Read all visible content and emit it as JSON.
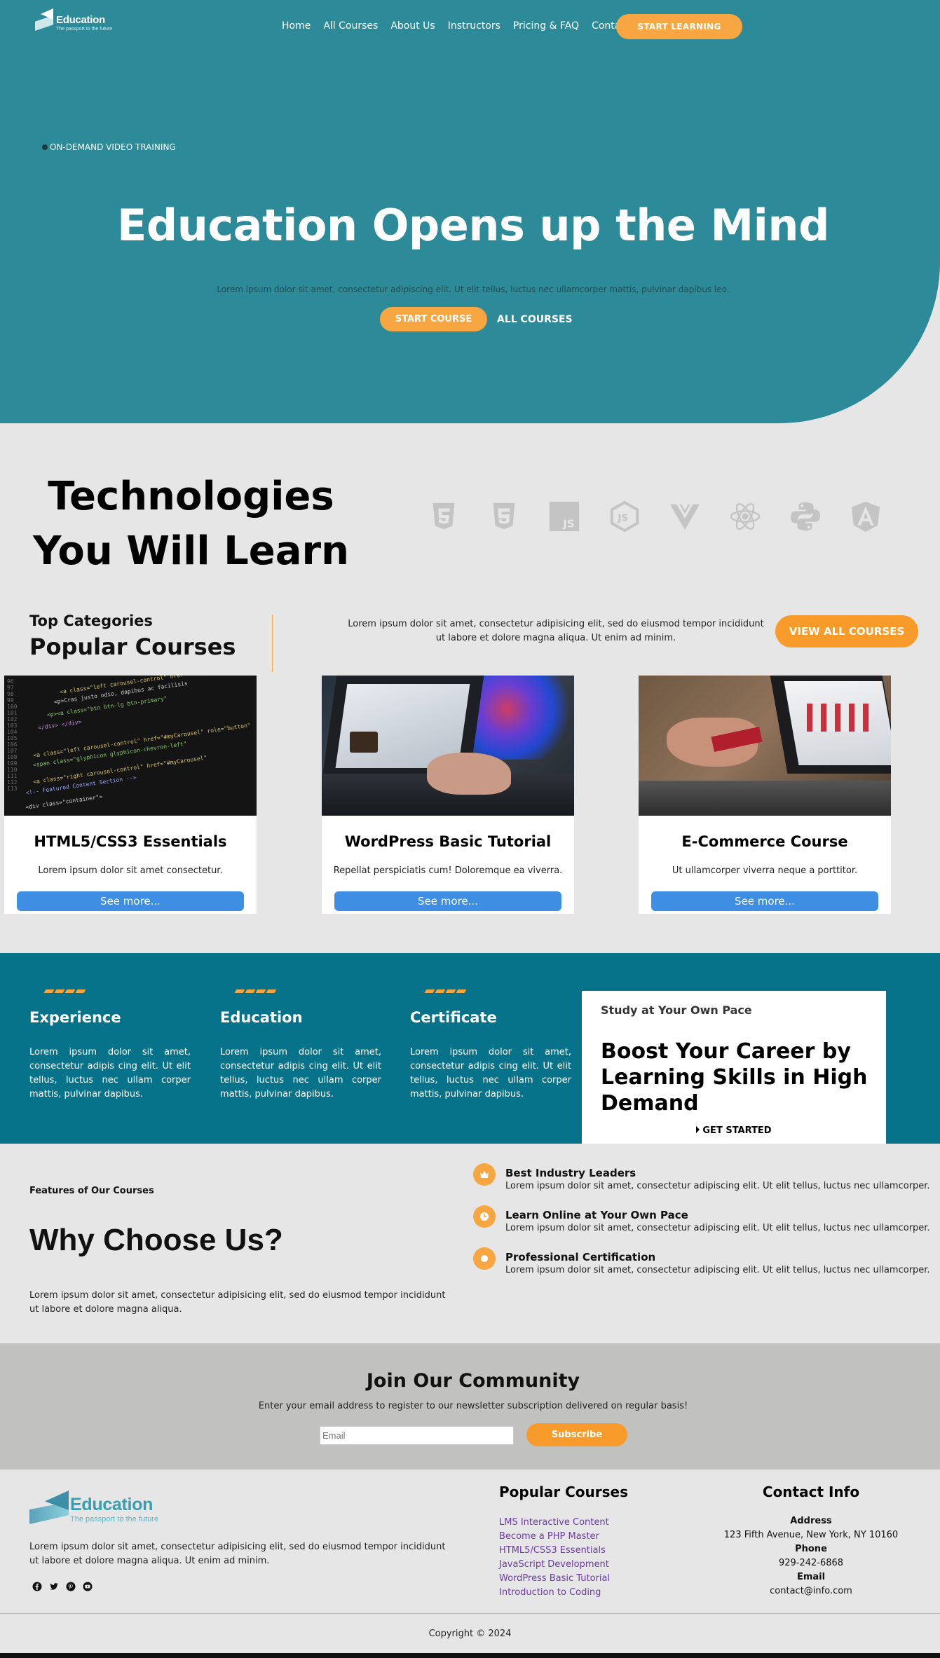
{
  "brand": {
    "name": "Education",
    "tagline": "The passport to the future"
  },
  "nav": {
    "links": [
      "Home",
      "All Courses",
      "About Us",
      "Instructors",
      "Pricing & FAQ",
      "Contact"
    ],
    "cta": "START LEARNING"
  },
  "hero": {
    "eyebrow": "ON-DEMAND VIDEO TRAINING",
    "title": "Education Opens up the Mind",
    "subtitle": "Lorem ipsum dolor sit amet, consectetur adipiscing elit. Ut elit tellus, luctus nec ullamcorper mattis, pulvinar dapibus leo.",
    "primary_button": "START COURSE",
    "secondary_button": "ALL COURSES",
    "colors": {
      "background": "#2c8a99",
      "accent": "#f7a641"
    }
  },
  "technologies": {
    "title_line1": "Technologies",
    "title_line2": "You Will Learn",
    "icons": [
      "html5-icon",
      "css3-icon",
      "javascript-icon",
      "nodejs-icon",
      "vuejs-icon",
      "react-icon",
      "python-icon",
      "angular-icon"
    ]
  },
  "popular": {
    "kicker": "Top Categories",
    "title": "Popular Courses",
    "description": "Lorem ipsum dolor sit amet, consectetur adipisicing elit, sed do eiusmod tempor incididunt ut labore et dolore magna aliqua. Ut enim ad minim.",
    "button": "VIEW ALL COURSES",
    "courses": [
      {
        "title": "HTML5/CSS3 Essentials",
        "description": "Lorem ipsum dolor sit amet consectetur.",
        "button": "See more..."
      },
      {
        "title": "WordPress Basic Tutorial",
        "description": "Repellat perspiciatis cum! Doloremque ea viverra.",
        "button": "See more..."
      },
      {
        "title": "E-Commerce Course",
        "description": "Ut ullamcorper viverra neque a porttitor.",
        "button": "See more..."
      }
    ]
  },
  "features": [
    {
      "title": "Experience",
      "text": "Lorem ipsum dolor sit amet, consectetur adipis cing elit. Ut elit tellus, luctus nec ullam corper mattis, pulvinar dapibus."
    },
    {
      "title": "Education",
      "text": "Lorem ipsum dolor sit amet, consectetur adipis cing elit. Ut elit tellus, luctus nec ullam corper mattis, pulvinar dapibus."
    },
    {
      "title": "Certificate",
      "text": "Lorem ipsum dolor sit amet, consectetur adipis cing elit. Ut elit tellus, luctus nec ullam corper mattis, pulvinar dapibus."
    }
  ],
  "boost": {
    "kicker": "Study at Your Own Pace",
    "title": "Boost Your Career by Learning Skills in High Demand",
    "button": "GET STARTED"
  },
  "why": {
    "kicker": "Features of Our Courses",
    "title": "Why Choose Us?",
    "description": "Lorem ipsum dolor sit amet, consectetur adipisicing elit, sed do eiusmod tempor incididunt ut labore et dolore magna aliqua.",
    "items": [
      {
        "icon": "crown-icon",
        "title": "Best Industry Leaders",
        "text": "Lorem ipsum dolor sit amet, consectetur adipiscing elit. Ut elit tellus, luctus nec ullamcorper."
      },
      {
        "icon": "clock-icon",
        "title": "Learn Online at Your Own Pace",
        "text": "Lorem ipsum dolor sit amet, consectetur adipiscing elit. Ut elit tellus, luctus nec ullamcorper."
      },
      {
        "icon": "circle-icon",
        "title": "Professional Certification",
        "text": "Lorem ipsum dolor sit amet, consectetur adipiscing elit. Ut elit tellus, luctus nec ullamcorper."
      }
    ]
  },
  "community": {
    "title": "Join Our Community",
    "description": "Enter your email address to register to our newsletter subscription delivered on regular basis!",
    "email_placeholder": "Email",
    "button": "Subscribe"
  },
  "footer": {
    "description": "Lorem ipsum dolor sit amet, consectetur adipisicing elit, sed do eiusmod tempor incididunt ut labore et dolore magna aliqua. Ut enim ad minim.",
    "social": [
      "facebook-icon",
      "twitter-icon",
      "pinterest-icon",
      "youtube-icon"
    ],
    "courses_title": "Popular Courses",
    "courses": [
      "LMS Interactive Content",
      "Become a PHP Master",
      "HTML5/CSS3 Essentials",
      "JavaScript Development",
      "WordPress Basic Tutorial",
      "Introduction to Coding"
    ],
    "contact_title": "Contact Info",
    "address_label": "Address",
    "address": "123 Fifth Avenue, New York, NY 10160",
    "phone_label": "Phone",
    "phone": "929-242-6868",
    "email_label": "Email",
    "email": "contact@info.com",
    "copyright": "Copyright © 2024"
  }
}
